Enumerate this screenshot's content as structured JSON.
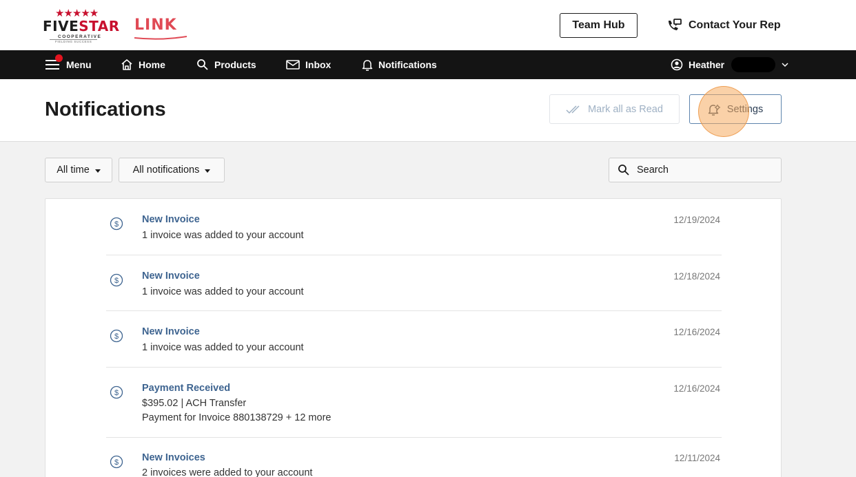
{
  "brand": {
    "stars": "★★★★★",
    "name_part1": "FIVE",
    "name_part2": "STAR",
    "sub": "COOPERATIVE",
    "tagline": "FIELDING SUCCESS",
    "product": "LINK"
  },
  "header": {
    "team_hub": "Team Hub",
    "contact_rep": "Contact Your Rep"
  },
  "nav": {
    "menu": "Menu",
    "home": "Home",
    "products": "Products",
    "inbox": "Inbox",
    "notifications": "Notifications",
    "user": "Heather"
  },
  "page": {
    "title": "Notifications",
    "mark_all_read": "Mark all as Read",
    "settings": "Settings"
  },
  "filters": {
    "time": "All time",
    "type": "All notifications",
    "search_placeholder": "Search"
  },
  "notifications": [
    {
      "title": "New Invoice",
      "lines": [
        "1 invoice was added to your account"
      ],
      "date": "12/19/2024",
      "icon": "dollar-circle-icon"
    },
    {
      "title": "New Invoice",
      "lines": [
        "1 invoice was added to your account"
      ],
      "date": "12/18/2024",
      "icon": "dollar-circle-icon"
    },
    {
      "title": "New Invoice",
      "lines": [
        "1 invoice was added to your account"
      ],
      "date": "12/16/2024",
      "icon": "dollar-circle-icon"
    },
    {
      "title": "Payment Received",
      "lines": [
        "$395.02 | ACH Transfer",
        "Payment for Invoice 880138729 + 12 more"
      ],
      "date": "12/16/2024",
      "icon": "dollar-circle-icon"
    },
    {
      "title": "New Invoices",
      "lines": [
        "2 invoices were added to your account"
      ],
      "date": "12/11/2024",
      "icon": "dollar-circle-icon"
    }
  ],
  "colors": {
    "brand_red": "#c8102e",
    "link_red": "#e04a55",
    "nav_bg": "#141414",
    "notif_title": "#3e6490",
    "highlight": "#f6ac60"
  }
}
